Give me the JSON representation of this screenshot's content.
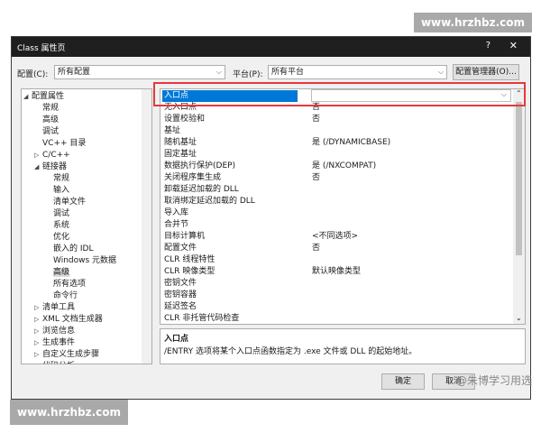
{
  "watermark_top": "www.hrzhbz.com",
  "watermark_bottom": "www.hrzhbz.com",
  "watermark_inline": "@朱博学习用选",
  "dialog": {
    "title": "Class 属性页",
    "help": "?",
    "close": "✕",
    "config_label": "配置(C):",
    "config_value": "所有配置",
    "platform_label": "平台(P):",
    "platform_value": "所有平台",
    "config_manager": "配置管理器(O)...",
    "ok": "确定",
    "cancel": "取消"
  },
  "tree": [
    {
      "label": "配置属性",
      "indent": 0,
      "exp": "◢"
    },
    {
      "label": "常规",
      "indent": 1,
      "exp": ""
    },
    {
      "label": "高级",
      "indent": 1,
      "exp": ""
    },
    {
      "label": "调试",
      "indent": 1,
      "exp": ""
    },
    {
      "label": "VC++ 目录",
      "indent": 1,
      "exp": ""
    },
    {
      "label": "C/C++",
      "indent": 1,
      "exp": "▷"
    },
    {
      "label": "链接器",
      "indent": 1,
      "exp": "◢"
    },
    {
      "label": "常规",
      "indent": 2,
      "exp": ""
    },
    {
      "label": "输入",
      "indent": 2,
      "exp": ""
    },
    {
      "label": "清单文件",
      "indent": 2,
      "exp": ""
    },
    {
      "label": "调试",
      "indent": 2,
      "exp": ""
    },
    {
      "label": "系统",
      "indent": 2,
      "exp": ""
    },
    {
      "label": "优化",
      "indent": 2,
      "exp": ""
    },
    {
      "label": "嵌入的 IDL",
      "indent": 2,
      "exp": ""
    },
    {
      "label": "Windows 元数据",
      "indent": 2,
      "exp": ""
    },
    {
      "label": "高级",
      "indent": 2,
      "exp": "",
      "selected": true
    },
    {
      "label": "所有选项",
      "indent": 2,
      "exp": ""
    },
    {
      "label": "命令行",
      "indent": 2,
      "exp": ""
    },
    {
      "label": "清单工具",
      "indent": 1,
      "exp": "▷"
    },
    {
      "label": "XML 文档生成器",
      "indent": 1,
      "exp": "▷"
    },
    {
      "label": "浏览信息",
      "indent": 1,
      "exp": "▷"
    },
    {
      "label": "生成事件",
      "indent": 1,
      "exp": "▷"
    },
    {
      "label": "自定义生成步骤",
      "indent": 1,
      "exp": "▷"
    },
    {
      "label": "代码分析",
      "indent": 1,
      "exp": "▷"
    }
  ],
  "properties": [
    {
      "name": "入口点",
      "value": "",
      "selected": true
    },
    {
      "name": "无入口点",
      "value": "否"
    },
    {
      "name": "设置校验和",
      "value": "否"
    },
    {
      "name": "基址",
      "value": ""
    },
    {
      "name": "随机基址",
      "value": "是 (/DYNAMICBASE)"
    },
    {
      "name": "固定基址",
      "value": ""
    },
    {
      "name": "数据执行保护(DEP)",
      "value": "是 (/NXCOMPAT)"
    },
    {
      "name": "关闭程序集生成",
      "value": "否"
    },
    {
      "name": "卸载延迟加载的 DLL",
      "value": ""
    },
    {
      "name": "取消绑定延迟加载的 DLL",
      "value": ""
    },
    {
      "name": "导入库",
      "value": ""
    },
    {
      "name": "合并节",
      "value": ""
    },
    {
      "name": "目标计算机",
      "value": "<不同选项>"
    },
    {
      "name": "配置文件",
      "value": "否"
    },
    {
      "name": "CLR 线程特性",
      "value": ""
    },
    {
      "name": "CLR 映像类型",
      "value": "默认映像类型"
    },
    {
      "name": "密钥文件",
      "value": ""
    },
    {
      "name": "密钥容器",
      "value": ""
    },
    {
      "name": "延迟签名",
      "value": ""
    },
    {
      "name": "CLR 非托管代码检查",
      "value": ""
    }
  ],
  "description": {
    "title": "入口点",
    "text": "/ENTRY 选项将某个入口点函数指定为 .exe 文件或 DLL 的起始地址。"
  }
}
